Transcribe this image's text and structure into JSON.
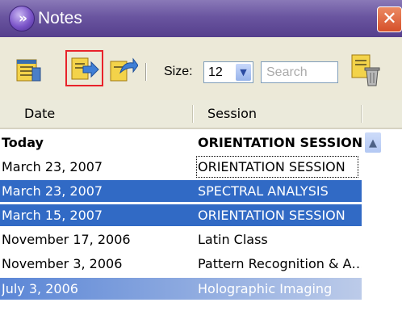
{
  "window": {
    "title": "Notes"
  },
  "titlebar": {
    "app_icon_glyph": "»",
    "close_glyph": "✕",
    "icon_color": "#7b55c9",
    "close_color": "#d5502a"
  },
  "toolbar": {
    "buttons": [
      {
        "name": "notes-list-icon",
        "selected": false
      },
      {
        "name": "import-note-icon",
        "selected": true
      },
      {
        "name": "export-note-icon",
        "selected": false
      },
      {
        "name": "delete-notes-icon",
        "selected": false
      }
    ],
    "size_label": "Size:",
    "size_value": "12",
    "size_arrow": "▼",
    "search_placeholder": "Search"
  },
  "columns": {
    "date": "Date",
    "session": "Session"
  },
  "rows": [
    {
      "date": "Today",
      "session": "ORIENTATION SESSION",
      "bold": true,
      "selected": false
    },
    {
      "date": "March 23, 2007",
      "session": "ORIENTATION SESSION",
      "bold": false,
      "selected": false,
      "focused": true
    },
    {
      "date": "March 23, 2007",
      "session": "SPECTRAL ANALYSIS",
      "bold": false,
      "selected": true
    },
    {
      "date": "March 15, 2007",
      "session": "ORIENTATION SESSION",
      "bold": false,
      "selected": true
    },
    {
      "date": "November 17, 2006",
      "session": "Latin Class",
      "bold": false,
      "selected": false
    },
    {
      "date": "November 3, 2006",
      "session": "Pattern Recognition & A…",
      "bold": false,
      "selected": false
    },
    {
      "date": "July 3, 2006",
      "session": "Holographic Imaging",
      "bold": false,
      "selected": true,
      "fading": true
    }
  ],
  "scrollbar": {
    "up_glyph": "▲"
  },
  "colors": {
    "selection": "#316ac5",
    "titlebar": "#6a55a0",
    "toolbar": "#ece9d8",
    "tool_highlight": "#e8222a"
  }
}
